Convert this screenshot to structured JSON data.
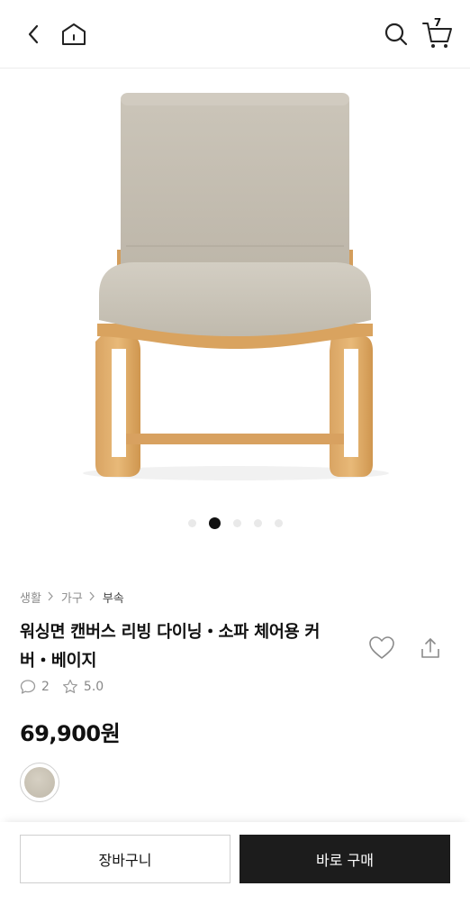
{
  "header": {
    "cart_count": "7",
    "icons": [
      "back-arrow-icon",
      "home-icon",
      "search-icon",
      "cart-icon"
    ]
  },
  "gallery": {
    "dots_total": 5,
    "active_index": 1
  },
  "breadcrumb": {
    "items": [
      "생활",
      "가구",
      "부속"
    ]
  },
  "product": {
    "title": "워싱면 캔버스 리빙 다이닝・소파 체어용 커버・베이지",
    "review_count": "2",
    "rating": "5.0",
    "price": "69,900원",
    "swatch_color": "#c9c3b6"
  },
  "actions": {
    "cart_label": "장바구니",
    "buy_label": "바로 구매"
  }
}
